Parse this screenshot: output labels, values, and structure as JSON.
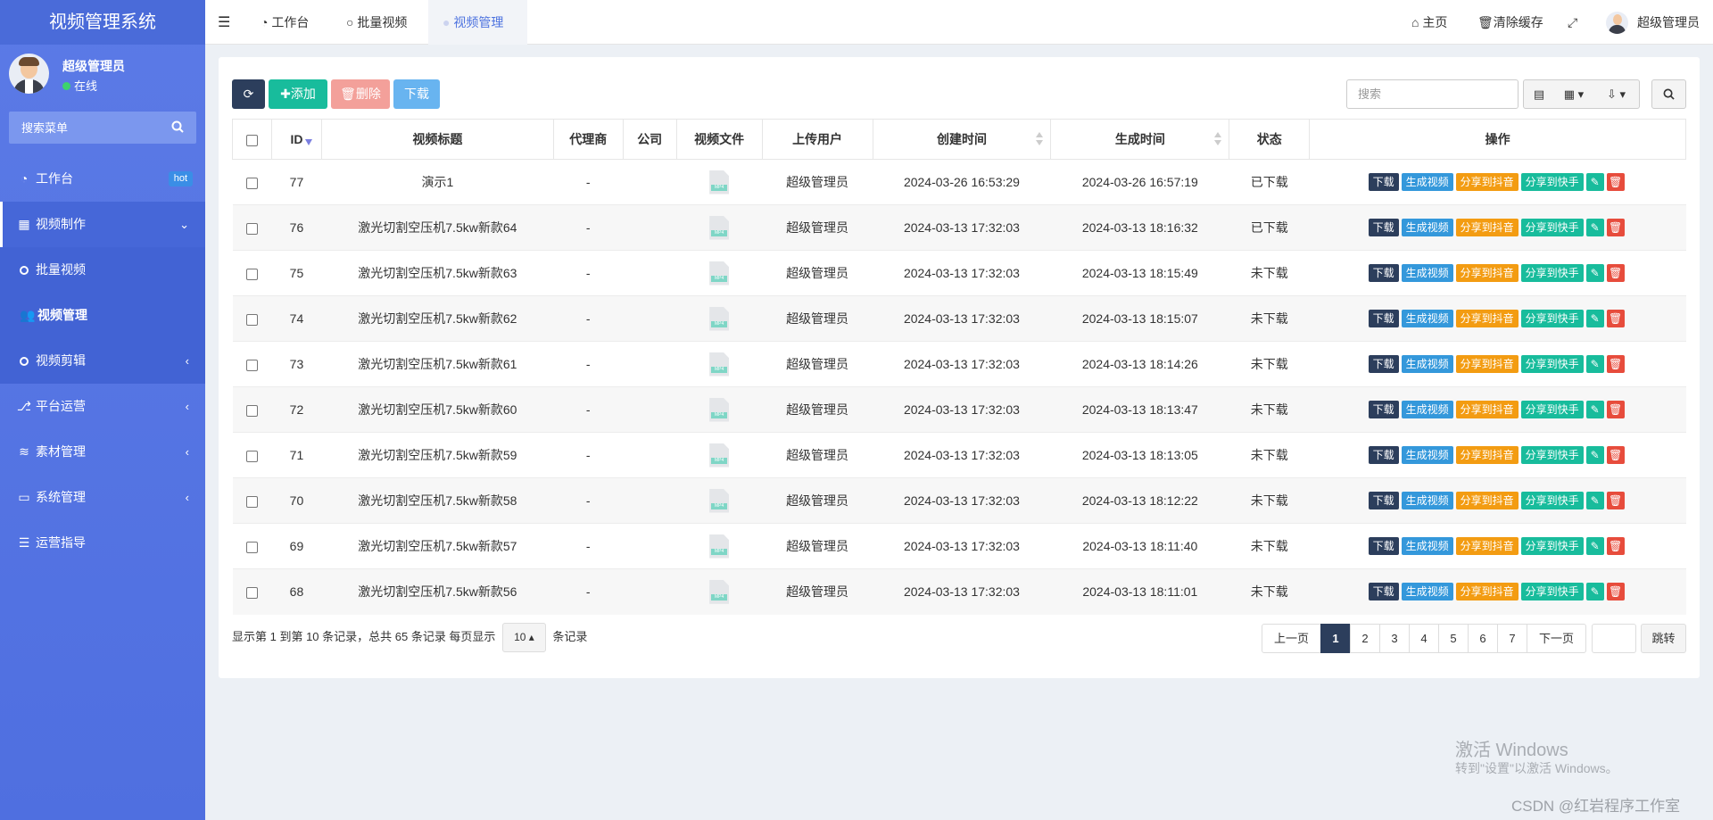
{
  "app": {
    "title": "视频管理系统"
  },
  "user": {
    "name": "超级管理员",
    "status": "在线"
  },
  "sidebar": {
    "search_placeholder": "搜索菜单",
    "items": [
      {
        "label": "工作台",
        "icon": "dashboard-icon",
        "badge": "hot"
      },
      {
        "label": "视频制作",
        "icon": "film-icon"
      },
      {
        "label": "批量视频",
        "icon": "circle-icon"
      },
      {
        "label": "视频管理",
        "icon": "users-icon"
      },
      {
        "label": "视频剪辑",
        "icon": "circle-icon"
      },
      {
        "label": "平台运营",
        "icon": "share-icon"
      },
      {
        "label": "素材管理",
        "icon": "layers-icon"
      },
      {
        "label": "系统管理",
        "icon": "monitor-icon"
      },
      {
        "label": "运营指导",
        "icon": "list-icon"
      }
    ]
  },
  "navbar": {
    "tabs": [
      "工作台",
      "批量视频",
      "视频管理"
    ],
    "home": "主页",
    "clear_cache": "清除缓存",
    "user": "超级管理员"
  },
  "toolbar": {
    "add": "添加",
    "delete": "删除",
    "download": "下载",
    "search_placeholder": "搜索"
  },
  "table": {
    "columns": [
      "ID",
      "视频标题",
      "代理商",
      "公司",
      "视频文件",
      "上传用户",
      "创建时间",
      "生成时间",
      "状态",
      "操作"
    ],
    "file_label": "MP4",
    "actions": {
      "download": "下载",
      "generate": "生成视频",
      "douyin": "分享到抖音",
      "kuaishou": "分享到快手"
    },
    "rows": [
      {
        "id": "77",
        "title": "演示1",
        "agent": "-",
        "company": "",
        "uploader": "超级管理员",
        "created": "2024-03-26 16:53:29",
        "generated": "2024-03-26 16:57:19",
        "status": "已下载"
      },
      {
        "id": "76",
        "title": "激光切割空压机7.5kw新款64",
        "agent": "-",
        "company": "",
        "uploader": "超级管理员",
        "created": "2024-03-13 17:32:03",
        "generated": "2024-03-13 18:16:32",
        "status": "已下载"
      },
      {
        "id": "75",
        "title": "激光切割空压机7.5kw新款63",
        "agent": "-",
        "company": "",
        "uploader": "超级管理员",
        "created": "2024-03-13 17:32:03",
        "generated": "2024-03-13 18:15:49",
        "status": "未下载"
      },
      {
        "id": "74",
        "title": "激光切割空压机7.5kw新款62",
        "agent": "-",
        "company": "",
        "uploader": "超级管理员",
        "created": "2024-03-13 17:32:03",
        "generated": "2024-03-13 18:15:07",
        "status": "未下载"
      },
      {
        "id": "73",
        "title": "激光切割空压机7.5kw新款61",
        "agent": "-",
        "company": "",
        "uploader": "超级管理员",
        "created": "2024-03-13 17:32:03",
        "generated": "2024-03-13 18:14:26",
        "status": "未下载"
      },
      {
        "id": "72",
        "title": "激光切割空压机7.5kw新款60",
        "agent": "-",
        "company": "",
        "uploader": "超级管理员",
        "created": "2024-03-13 17:32:03",
        "generated": "2024-03-13 18:13:47",
        "status": "未下载"
      },
      {
        "id": "71",
        "title": "激光切割空压机7.5kw新款59",
        "agent": "-",
        "company": "",
        "uploader": "超级管理员",
        "created": "2024-03-13 17:32:03",
        "generated": "2024-03-13 18:13:05",
        "status": "未下载"
      },
      {
        "id": "70",
        "title": "激光切割空压机7.5kw新款58",
        "agent": "-",
        "company": "",
        "uploader": "超级管理员",
        "created": "2024-03-13 17:32:03",
        "generated": "2024-03-13 18:12:22",
        "status": "未下载"
      },
      {
        "id": "69",
        "title": "激光切割空压机7.5kw新款57",
        "agent": "-",
        "company": "",
        "uploader": "超级管理员",
        "created": "2024-03-13 17:32:03",
        "generated": "2024-03-13 18:11:40",
        "status": "未下载"
      },
      {
        "id": "68",
        "title": "激光切割空压机7.5kw新款56",
        "agent": "-",
        "company": "",
        "uploader": "超级管理员",
        "created": "2024-03-13 17:32:03",
        "generated": "2024-03-13 18:11:01",
        "status": "未下载"
      }
    ]
  },
  "pagination": {
    "info_prefix": "显示第 1 到第 10 条记录，总共 65 条记录 每页显示",
    "page_size": "10",
    "info_suffix": "条记录",
    "prev": "上一页",
    "pages": [
      "1",
      "2",
      "3",
      "4",
      "5",
      "6",
      "7"
    ],
    "current": "1",
    "next": "下一页",
    "goto": "跳转"
  },
  "watermark": {
    "line1": "激活 Windows",
    "line2": "转到\"设置\"以激活 Windows。"
  },
  "credit": "CSDN @红岩程序工作室",
  "colors": {
    "sidebar": "#4f6fe0",
    "dark": "#2c3e5c",
    "success": "#18bc9c",
    "info": "#3498db",
    "warning": "#f39c12",
    "danger": "#e74c3c"
  }
}
